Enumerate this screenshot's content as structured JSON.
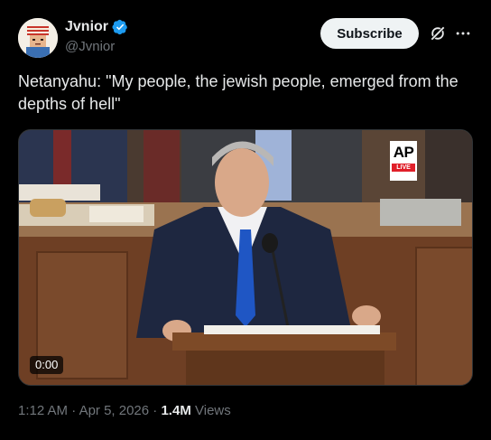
{
  "author": {
    "display_name": "Jvnior",
    "handle": "@Jvnior",
    "verified_color": "#1d9bf0"
  },
  "actions": {
    "subscribe_label": "Subscribe",
    "grok_icon": "grok-icon",
    "more_icon": "more-horizontal-icon"
  },
  "post": {
    "text": "Netanyahu: \"My people, the jewish people, emerged from the depths of hell\""
  },
  "media": {
    "badge_brand": "AP",
    "badge_live": "LIVE",
    "timecode": "0:00"
  },
  "meta": {
    "time": "1:12 AM",
    "separator": "·",
    "date": "Apr 5, 2026",
    "views_count": "1.4M",
    "views_label": "Views"
  },
  "colors": {
    "background": "#000000",
    "text_primary": "#e7e9ea",
    "text_secondary": "#71767b",
    "button_bg": "#eff3f4",
    "live_red": "#e0202a"
  }
}
